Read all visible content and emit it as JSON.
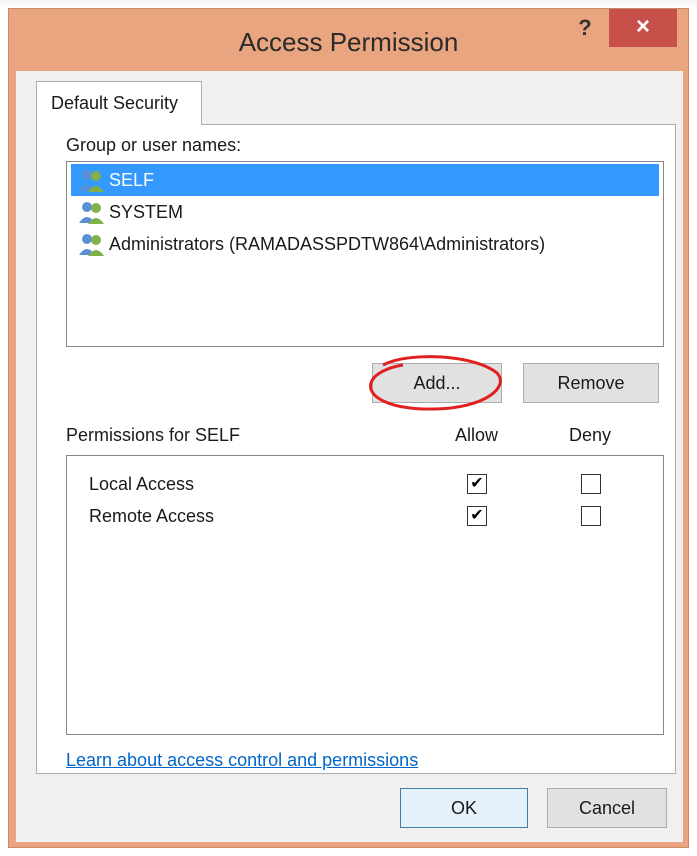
{
  "window": {
    "title": "Access Permission",
    "help_label": "?",
    "close_label": "×"
  },
  "tab": {
    "label": "Default Security"
  },
  "group_label": "Group or user names:",
  "users": [
    {
      "name": "SELF",
      "selected": true
    },
    {
      "name": "SYSTEM",
      "selected": false
    },
    {
      "name": "Administrators (RAMADASSPDTW864\\Administrators)",
      "selected": false
    }
  ],
  "buttons": {
    "add": "Add...",
    "remove": "Remove",
    "ok": "OK",
    "cancel": "Cancel"
  },
  "permissions": {
    "title": "Permissions for SELF",
    "allow_header": "Allow",
    "deny_header": "Deny",
    "rows": [
      {
        "name": "Local Access",
        "allow": true,
        "deny": false
      },
      {
        "name": "Remote Access",
        "allow": true,
        "deny": false
      }
    ]
  },
  "link_text": "Learn about access control and permissions",
  "colors": {
    "window_frame": "#e9a57f",
    "close_button": "#c7504b",
    "selection": "#3399ff",
    "link": "#0066cc",
    "annotation_circle": "#e02020"
  }
}
